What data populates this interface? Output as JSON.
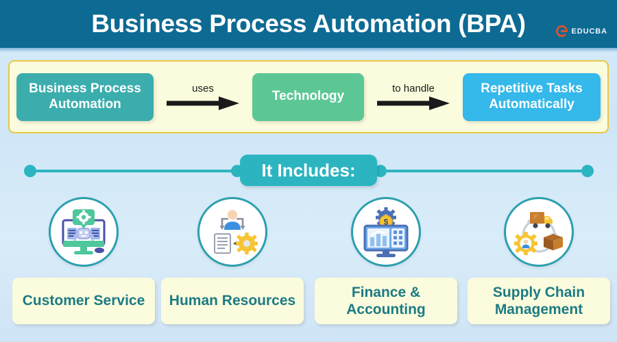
{
  "header": {
    "title": "Business Process Automation (BPA)",
    "brand_name": "EDUCBA",
    "brand_icon": "educba-e-logo-icon",
    "bar_color": "#0d6a93",
    "title_color": "#ffffff"
  },
  "flow": {
    "panel_bg": "#fbfbdd",
    "panel_border": "#e8c840",
    "steps": [
      {
        "label": "Business Process Automation",
        "color": "#3cadad"
      },
      {
        "label": "Technology",
        "color": "#5cc795"
      },
      {
        "label": "Repetitive Tasks Automatically",
        "color": "#35b8ea"
      }
    ],
    "connectors": [
      {
        "label": "uses",
        "icon": "arrow-right-icon"
      },
      {
        "label": "to handle",
        "icon": "arrow-right-icon"
      }
    ]
  },
  "includes": {
    "badge_label": "It Includes:",
    "accent_color": "#2cb5c0"
  },
  "categories": [
    {
      "label": "Customer Service",
      "icon": "customer-service-chatbot-monitor-icon",
      "circle_border": "#2b9fae"
    },
    {
      "label": "Human Resources",
      "icon": "human-resources-person-document-gear-icon",
      "circle_border": "#2b9fae"
    },
    {
      "label": "Finance & Accounting",
      "icon": "finance-accounting-monitor-calculator-icon",
      "circle_border": "#2b9fae"
    },
    {
      "label": "Supply Chain Management",
      "icon": "supply-chain-truck-box-gear-icon",
      "circle_border": "#2b9fae"
    }
  ],
  "theme": {
    "page_background": "#d6eaf8",
    "label_box_bg": "#fbfbdd",
    "label_text_color": "#1b7b84"
  }
}
